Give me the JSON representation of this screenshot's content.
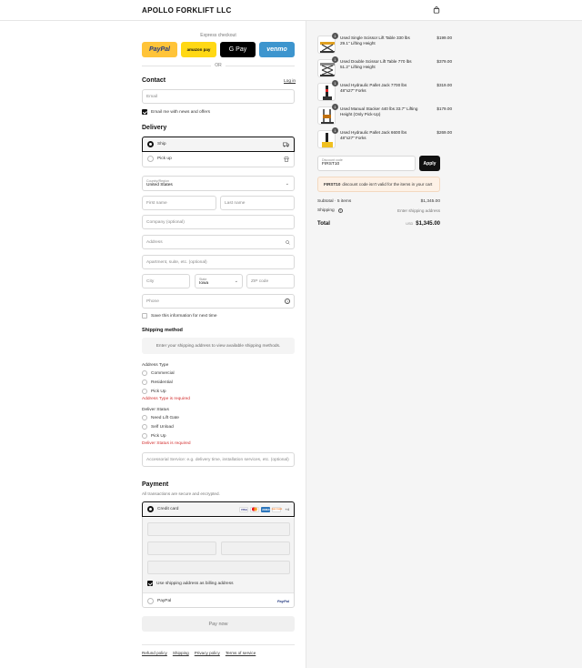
{
  "header": {
    "brand": "APOLLO FORKLIFT LLC",
    "cart_icon": "shopping-bag-icon"
  },
  "express": {
    "label": "Express checkout",
    "buttons": [
      {
        "label": "PayPal",
        "color": "#ffc439"
      },
      {
        "label": "amazon pay",
        "color": "#ffd814"
      },
      {
        "label": "G Pay",
        "color": "#000000"
      },
      {
        "label": "venmo",
        "color": "#3d95ce"
      }
    ],
    "or": "OR"
  },
  "contact": {
    "title": "Contact",
    "login": "Log in",
    "email_placeholder": "Email",
    "news_label": "Email me with news and offers",
    "news_checked": true
  },
  "delivery": {
    "title": "Delivery",
    "options": [
      {
        "label": "Ship",
        "selected": true
      },
      {
        "label": "Pick up",
        "selected": false
      }
    ],
    "country_label": "Country/Region",
    "country_value": "United States",
    "first_name": "First name",
    "last_name": "Last name",
    "company": "Company (optional)",
    "address": "Address",
    "apartment": "Apartment, suite, etc. (optional)",
    "city": "City",
    "state_label": "State",
    "state_value": "Iowa",
    "zip": "ZIP code",
    "phone": "Phone",
    "save_info": "Save this information for next time"
  },
  "shipping": {
    "title": "Shipping method",
    "message": "Enter your shipping address to view available shipping methods."
  },
  "address_type": {
    "title": "Address Type",
    "options": [
      "Commercial",
      "Residential",
      "Pick Up"
    ],
    "error": "Address Type is required"
  },
  "deliver_status": {
    "title": "Deliver Status",
    "options": [
      "Need Lift Gate",
      "Self Unload",
      "Pick Up"
    ],
    "error": "Deliver Status is required"
  },
  "accessorial_placeholder": "Accessorial Service: e.g. delivery time, installation services, etc. (optional)",
  "payment": {
    "title": "Payment",
    "subtitle": "All transactions are secure and encrypted.",
    "credit_card": "Credit card",
    "card_logos": [
      "VISA",
      "MC",
      "AMEX",
      "DISCOVER"
    ],
    "more": "+4",
    "billing_label": "Use shipping address as billing address",
    "billing_checked": true,
    "paypal": "PayPal"
  },
  "pay_now": "Pay now",
  "footer_links": [
    "Refund policy",
    "Shipping",
    "Privacy policy",
    "Terms of service"
  ],
  "cart": {
    "items": [
      {
        "qty": "1",
        "name": "Used Single Scissor Lift Table 330 lbs 29.1\" Lifting Height",
        "price": "$199.00"
      },
      {
        "qty": "1",
        "name": "Used Double Scissor Lift Table 770 lbs 51.2\" Lifting Height",
        "price": "$379.00"
      },
      {
        "qty": "1",
        "name": "Used Hydraulic Pallet Jack 7700 lbs 48\"x27\" Forks",
        "price": "$319.00"
      },
      {
        "qty": "1",
        "name": "Used Manual Stacker 440 lbs 33.7\" Lifting Height (Only Pick-Up)",
        "price": "$179.00"
      },
      {
        "qty": "1",
        "name": "Used Hydraulic Pallet Jack 6600 lbs 48\"x27\" Forks",
        "price": "$269.00"
      }
    ],
    "discount_label": "Discount code",
    "discount_value": "FIRST10",
    "apply": "Apply",
    "discount_code": "FIRST10",
    "discount_error": "discount code isn't valid for the items in your cart",
    "subtotal_label": "Subtotal · 5 items",
    "subtotal_value": "$1,345.00",
    "shipping_label": "Shipping",
    "shipping_value": "Enter shipping address",
    "total_label": "Total",
    "currency": "USD",
    "total_value": "$1,345.00"
  }
}
